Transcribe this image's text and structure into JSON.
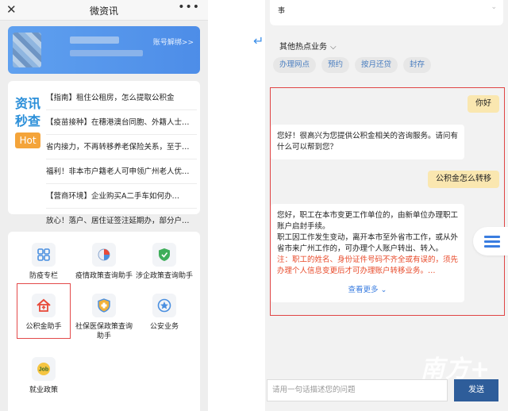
{
  "left": {
    "topbar": {
      "close": "✕",
      "title": "微资讯",
      "more": "•••"
    },
    "banner": {
      "unbind_label": "账号解绑>>"
    },
    "news": {
      "brand_line1": "资讯",
      "brand_line2": "秒查",
      "hot_badge": "Hot",
      "items": [
        "【指南】租住公租房，怎么提取公积金",
        "【疫苗接种】在穗港澳台同胞、外籍人士…",
        "省内接力，不再转移养老保险关系，至于…",
        "福利！非本市户籍老人可申领广州老人优…",
        "【营商环境】企业购买A二手车如何办…",
        "放心！落户、居住证签注延期办，部分户…"
      ]
    },
    "grid": {
      "tiles": [
        {
          "label": "防疫专栏"
        },
        {
          "label": "疫情政策查询助手"
        },
        {
          "label": "涉企政策查询助手"
        },
        {
          "label": "公积金助手"
        },
        {
          "label": "社保医保政策查询助手"
        },
        {
          "label": "公安业务"
        },
        {
          "label": "就业政策",
          "icon_text": "Job"
        }
      ]
    }
  },
  "right": {
    "prev_card": {
      "text": "事",
      "chevron": "⌄"
    },
    "back_icon": "↵",
    "hot_business": {
      "label": "其他热点业务",
      "chevron": "⌵"
    },
    "chips": [
      "办理网点",
      "预约",
      "按月还贷",
      "封存"
    ],
    "chat": {
      "user_msg_1": "你好",
      "bot_msg_1": "您好！很高兴为您提供公积金相关的咨询服务。请问有什么可以帮到您？",
      "user_msg_2": "公积金怎么转移",
      "bot_msg_2_p1": "您好，职工在本市变更工作单位的，由新单位办理职工账户启封手续。",
      "bot_msg_2_p2": "职工因工作发生变动，离开本市至外省市工作，或从外省市来广州工作的，可办理个人账户转出、转入。",
      "bot_msg_2_note": "注：职工的姓名、身份证件号码不齐全或有误的，须先办理个人信息变更后才可办理账户转移业务。…",
      "see_more": "查看更多",
      "see_more_chevron": "⌄"
    },
    "input": {
      "placeholder": "请用一句话描述您的问题",
      "send_label": "发送"
    }
  },
  "watermark": "南方+",
  "colors": {
    "accent_blue": "#3a7de0",
    "highlight_red": "#e04545",
    "user_bubble": "#fae7b0",
    "send_button": "#2e5d9a",
    "hot_badge": "#f4a43a",
    "warning_text": "#e84a2a"
  }
}
